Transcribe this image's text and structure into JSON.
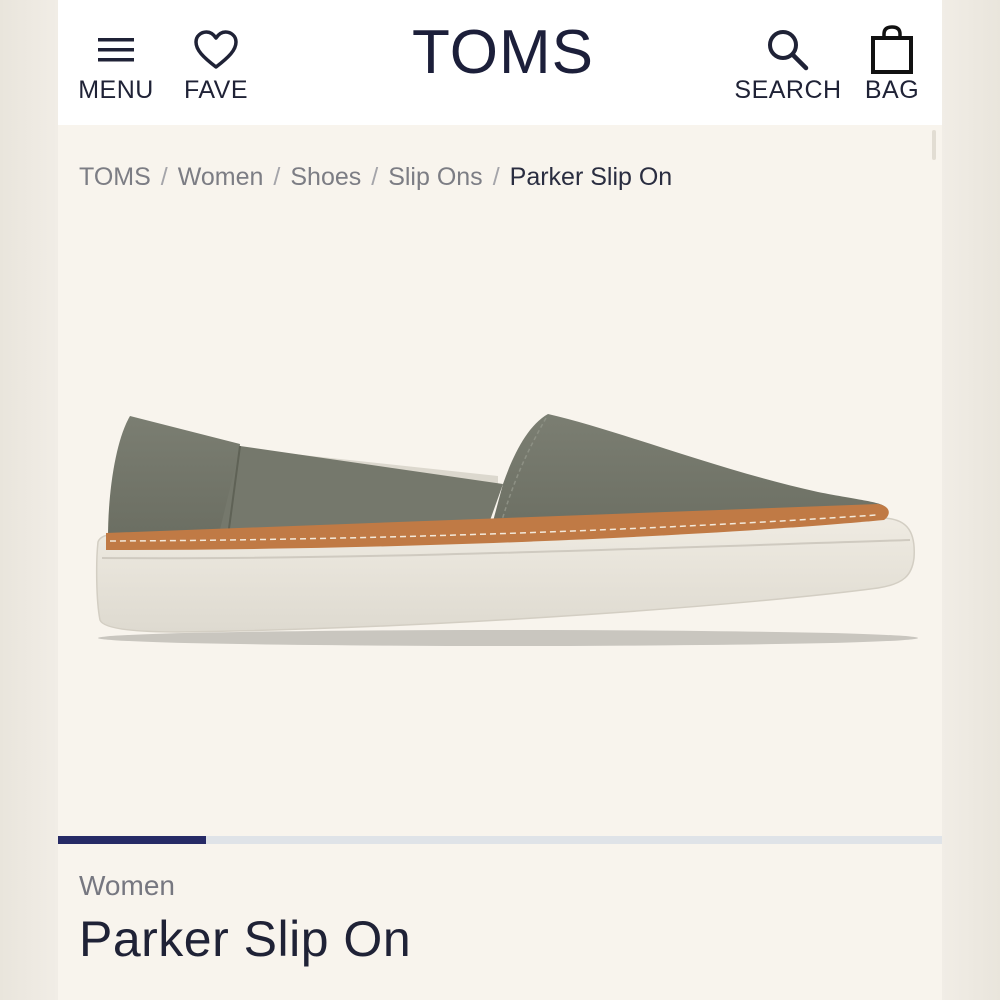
{
  "header": {
    "logo": "TOMS",
    "menu_label": "MENU",
    "fave_label": "FAVE",
    "search_label": "SEARCH",
    "bag_label": "BAG"
  },
  "breadcrumb": {
    "items": [
      "TOMS",
      "Women",
      "Shoes",
      "Slip Ons"
    ],
    "separator": "/",
    "current": "Parker Slip On"
  },
  "gallery": {
    "progress": 0.167,
    "accent_color": "#262a66",
    "track_color": "#dfe3e8"
  },
  "product": {
    "category": "Women",
    "name": "Parker Slip On"
  }
}
